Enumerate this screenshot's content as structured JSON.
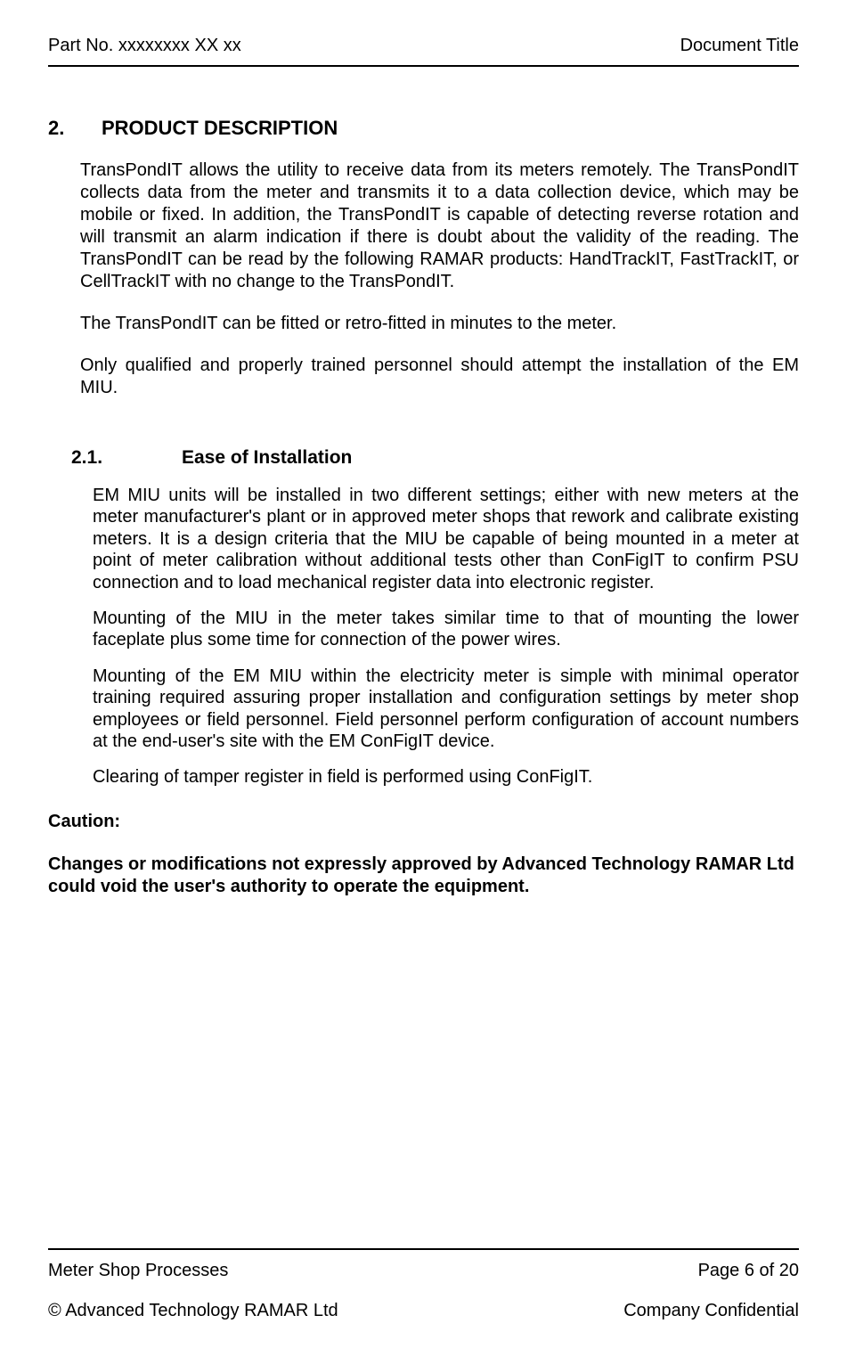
{
  "header": {
    "left": "Part No. xxxxxxxx XX xx",
    "right": "Document Title"
  },
  "section2": {
    "number": "2.",
    "title": "PRODUCT DESCRIPTION",
    "p1": "TransPondIT allows the utility to receive data from its meters remotely. The TransPondIT collects data from the meter and transmits it to a data collection device, which may be mobile or fixed. In addition, the TransPondIT is capable of detecting reverse rotation and will transmit an alarm indication if there is doubt about the validity of the reading. The TransPondIT can be read by the following RAMAR products: HandTrackIT, FastTrackIT, or CellTrackIT with no change to the TransPondIT.",
    "p2": "The TransPondIT can be fitted or retro-fitted in minutes to the meter.",
    "p3": "Only qualified and properly trained personnel should attempt the installation of the EM MIU."
  },
  "section21": {
    "number": "2.1.",
    "title": "Ease of Installation",
    "p1": "EM MIU units will be installed in two different settings; either with new meters at the meter manufacturer's plant or in approved meter shops that rework and calibrate existing meters.  It is a design criteria that the MIU be capable of being mounted in a meter at point of meter calibration without additional tests other than ConFigIT to confirm PSU connection and to load mechanical register data into electronic register.",
    "p2": "Mounting of the MIU in the meter takes similar time to that of mounting the lower faceplate plus some time for connection of the power wires.",
    "p3": "Mounting of the EM MIU within the electricity meter is simple with minimal operator training required assuring proper installation and configuration settings by meter shop employees or field personnel.  Field personnel perform configuration of account numbers at the end-user's site with the EM ConFigIT device.",
    "p4": "Clearing of tamper register in field is performed using ConFigIT."
  },
  "caution": {
    "label": "Caution:",
    "body": "Changes or modifications not expressly approved by Advanced Technology RAMAR Ltd could void the user's authority to operate the equipment."
  },
  "footer": {
    "left1": "Meter Shop Processes",
    "right1": "Page 6 of 20",
    "left2": "© Advanced Technology RAMAR Ltd",
    "right2": "Company Confidential"
  }
}
